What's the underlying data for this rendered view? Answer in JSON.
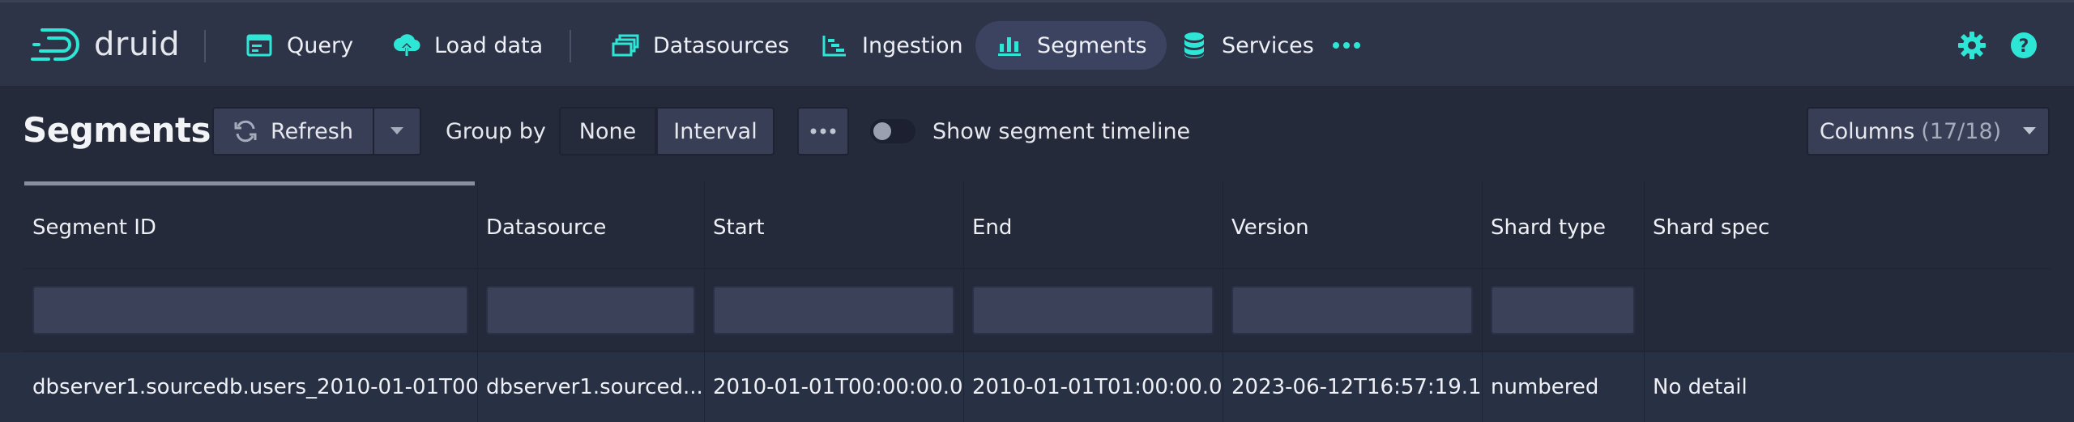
{
  "app": {
    "name": "druid"
  },
  "nav": {
    "query": "Query",
    "load_data": "Load data",
    "datasources": "Datasources",
    "ingestion": "Ingestion",
    "segments": "Segments",
    "services": "Services",
    "active": "Segments"
  },
  "icons": {
    "query": "query-console-icon",
    "load_data": "cloud-upload-icon",
    "datasources": "multi-select-icon",
    "ingestion": "gantt-chart-icon",
    "segments": "stacked-chart-icon",
    "services": "database-icon",
    "more": "more-dots-icon",
    "settings": "gear-icon",
    "help": "help-icon"
  },
  "colors": {
    "accent": "#2ee6d6",
    "active_tab_bg": "#3b4360"
  },
  "page": {
    "title": "Segments",
    "refresh": "Refresh",
    "group_by_label": "Group by",
    "group_none": "None",
    "group_interval": "Interval",
    "timeline_label": "Show segment timeline",
    "columns_label": "Columns",
    "columns_count": "(17/18)"
  },
  "table": {
    "headers": [
      "Segment ID",
      "Datasource",
      "Start",
      "End",
      "Version",
      "Shard type",
      "Shard spec"
    ],
    "rows": [
      [
        "dbserver1.sourcedb.users_2010-01-01T00:...",
        "dbserver1.sourced...",
        "2010-01-01T00:00:00.0...",
        "2010-01-01T01:00:00.0...",
        "2023-06-12T16:57:19.1...",
        "numbered",
        "No detail"
      ]
    ]
  }
}
